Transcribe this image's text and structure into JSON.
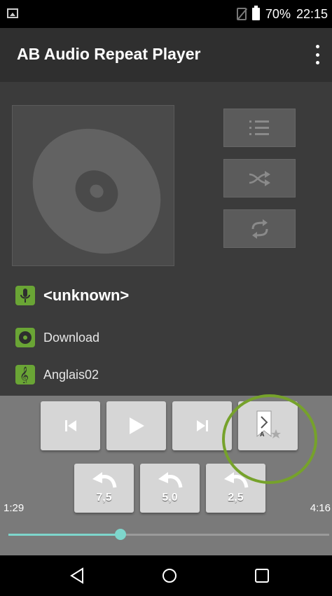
{
  "status_bar": {
    "battery": "70%",
    "time": "22:15",
    "icons": [
      "image-notification-icon",
      "no-sim-icon",
      "battery-icon"
    ]
  },
  "app_bar": {
    "title": "AB Audio Repeat Player",
    "menu_icon": "overflow-menu-icon"
  },
  "side_buttons": [
    {
      "name": "playlist-button",
      "icon": "playlist-icon"
    },
    {
      "name": "shuffle-button",
      "icon": "shuffle-icon"
    },
    {
      "name": "repeat-button",
      "icon": "repeat-icon"
    }
  ],
  "track_info": {
    "artist": "<unknown>",
    "album": "Download",
    "title": "Anglais02"
  },
  "player": {
    "rewind_buttons": [
      "7,5",
      "5,0",
      "2,5"
    ],
    "elapsed": "1:29",
    "duration": "4:16",
    "progress_fraction": 0.35
  },
  "colors": {
    "accent_green": "#6aa535",
    "seek_teal": "#7ed6cc",
    "highlight_circle": "#76a22b"
  }
}
